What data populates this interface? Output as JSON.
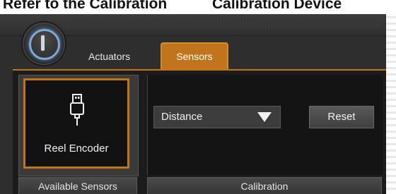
{
  "doc": {
    "heading_left": "Refer to the Calibration",
    "heading_right": "Calibration Device"
  },
  "tabs": [
    {
      "label": "Actuators"
    },
    {
      "label": "Sensors"
    }
  ],
  "sensors": {
    "items": [
      {
        "label": "Reel Encoder",
        "icon": "usb-icon"
      }
    ]
  },
  "calibration": {
    "dropdown_value": "Distance",
    "reset_label": "Reset"
  },
  "footer": {
    "left": "Available Sensors",
    "mid": "Calibration"
  },
  "colors": {
    "accent": "#c2741c",
    "logo_ring": "#7fa9d6"
  }
}
